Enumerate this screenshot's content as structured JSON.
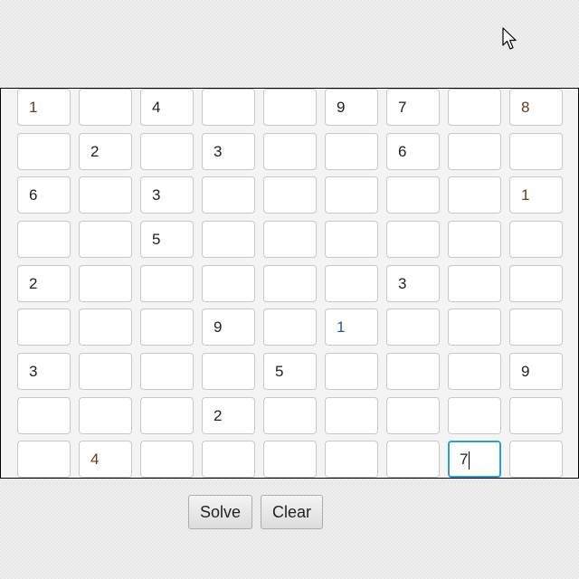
{
  "grid": [
    [
      "1",
      "",
      "4",
      "",
      "",
      "9",
      "7",
      "",
      "8"
    ],
    [
      "",
      "2",
      "",
      "3",
      "",
      "",
      "6",
      "",
      ""
    ],
    [
      "6",
      "",
      "3",
      "",
      "",
      "",
      "",
      "",
      "1"
    ],
    [
      "",
      "",
      "5",
      "",
      "",
      "",
      "",
      "",
      ""
    ],
    [
      "2",
      "",
      "",
      "",
      "",
      "",
      "3",
      "",
      ""
    ],
    [
      "",
      "",
      "",
      "9",
      "",
      "1",
      "",
      "",
      ""
    ],
    [
      "3",
      "",
      "",
      "",
      "5",
      "",
      "",
      "",
      "9"
    ],
    [
      "",
      "",
      "",
      "2",
      "",
      "",
      "",
      "",
      ""
    ],
    [
      "",
      "4",
      "",
      "",
      "",
      "",
      "",
      "7",
      ""
    ]
  ],
  "focused_cell": {
    "row": 8,
    "col": 7
  },
  "colors": {
    "brown": "#6b3a10",
    "blue": "#1f5c9e",
    "dark": "#222222",
    "focus_border": "#2a9fd6"
  },
  "brown_cells": [
    [
      0,
      0
    ],
    [
      0,
      8
    ],
    [
      2,
      8
    ],
    [
      8,
      1
    ]
  ],
  "blue_cells": [
    [
      5,
      5
    ]
  ],
  "buttons": {
    "solve_label": "Solve",
    "clear_label": "Clear"
  },
  "cursor_icon": "arrow-pointer-icon"
}
